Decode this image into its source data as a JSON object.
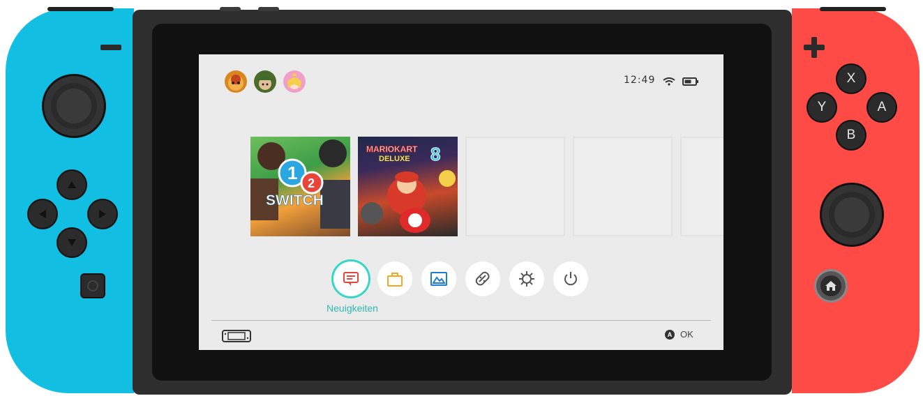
{
  "status": {
    "time": "12:49"
  },
  "users": [
    {
      "name": "bowser-avatar",
      "color": "#d9861e",
      "accent": "#7a3d12"
    },
    {
      "name": "link-avatar",
      "color": "#4a6b2a",
      "accent": "#c8a068"
    },
    {
      "name": "peach-avatar",
      "color": "#f0a0c8",
      "accent": "#f5cf4a"
    }
  ],
  "games": [
    {
      "id": "1-2-switch",
      "title_line1": "1",
      "title_line2": "2",
      "title_line3": "SWITCH"
    },
    {
      "id": "mario-kart-8",
      "title_line1": "MARIOKART",
      "title_line2": "8",
      "title_line3": "DELUXE"
    }
  ],
  "apps": [
    {
      "name": "news-button",
      "icon": "news-icon",
      "label": "Neuigkeiten",
      "color": "#e8443a",
      "selected": true
    },
    {
      "name": "eshop-button",
      "icon": "shopping-bag-icon",
      "color": "#f5a623"
    },
    {
      "name": "album-button",
      "icon": "album-icon",
      "color": "#1f7bd6"
    },
    {
      "name": "controllers-button",
      "icon": "joycon-icon",
      "color": "#555555"
    },
    {
      "name": "settings-button",
      "icon": "gear-icon",
      "color": "#555555"
    },
    {
      "name": "sleep-button",
      "icon": "power-icon",
      "color": "#555555"
    }
  ],
  "footer": {
    "a_button": "A",
    "ok": "OK"
  },
  "controls": {
    "x": "X",
    "y": "Y",
    "a": "A",
    "b": "B"
  },
  "colors": {
    "screen_bg": "#ebebeb",
    "accent": "#34d6c8",
    "neon_blue": "#12bfe2",
    "neon_red": "#ff4b46"
  }
}
